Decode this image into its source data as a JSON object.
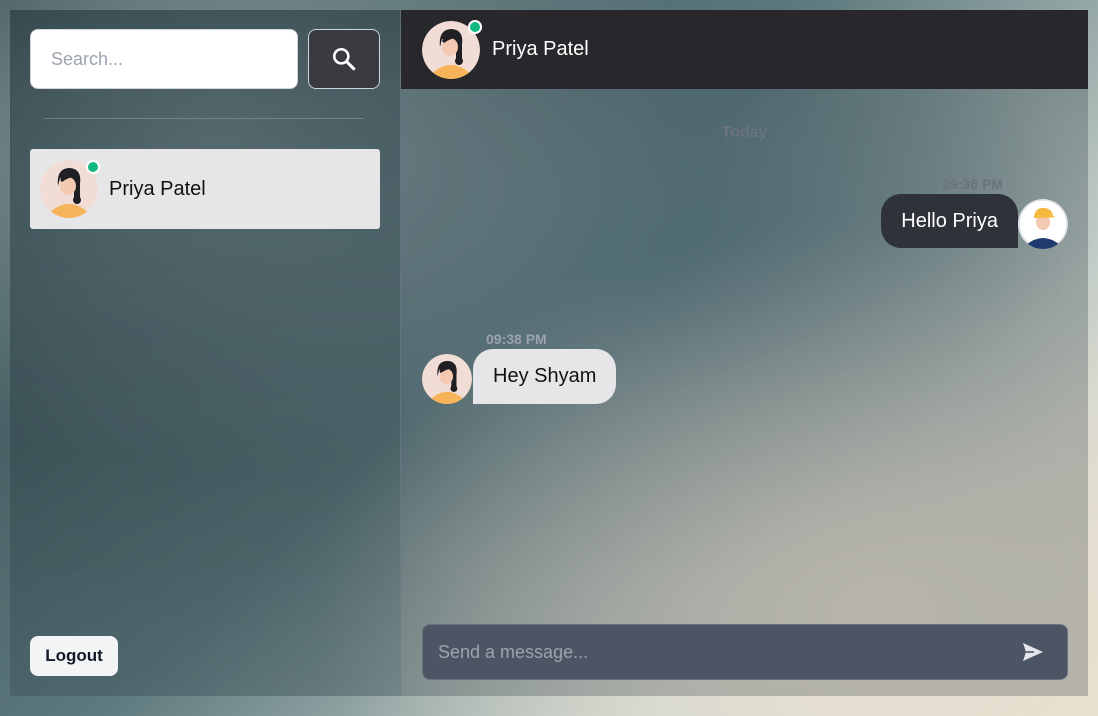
{
  "sidebar": {
    "search": {
      "placeholder": "Search..."
    },
    "search_button_icon": "search-icon",
    "conversations": [
      {
        "name": "Priya Patel",
        "online": true,
        "avatar": "female-avatar"
      }
    ],
    "logout_label": "Logout"
  },
  "chat": {
    "header": {
      "name": "Priya Patel",
      "online": true
    },
    "messages": [
      {
        "day": "Today",
        "time": "09:36 PM",
        "text": "Hello Priya",
        "direction": "outgoing",
        "avatar": "male-avatar"
      },
      {
        "day": "Today",
        "time": "09:38 PM",
        "text": "Hey Shyam",
        "direction": "incoming",
        "avatar": "female-avatar"
      }
    ],
    "composer": {
      "placeholder": "Send a message...",
      "send_icon": "send-icon"
    }
  },
  "colors": {
    "online": "#10b981",
    "header_bg": "#28282c",
    "outgoing_bubble": "#2f3238",
    "incoming_bubble": "#e6e6e8",
    "composer_bg": "#4b5563"
  }
}
